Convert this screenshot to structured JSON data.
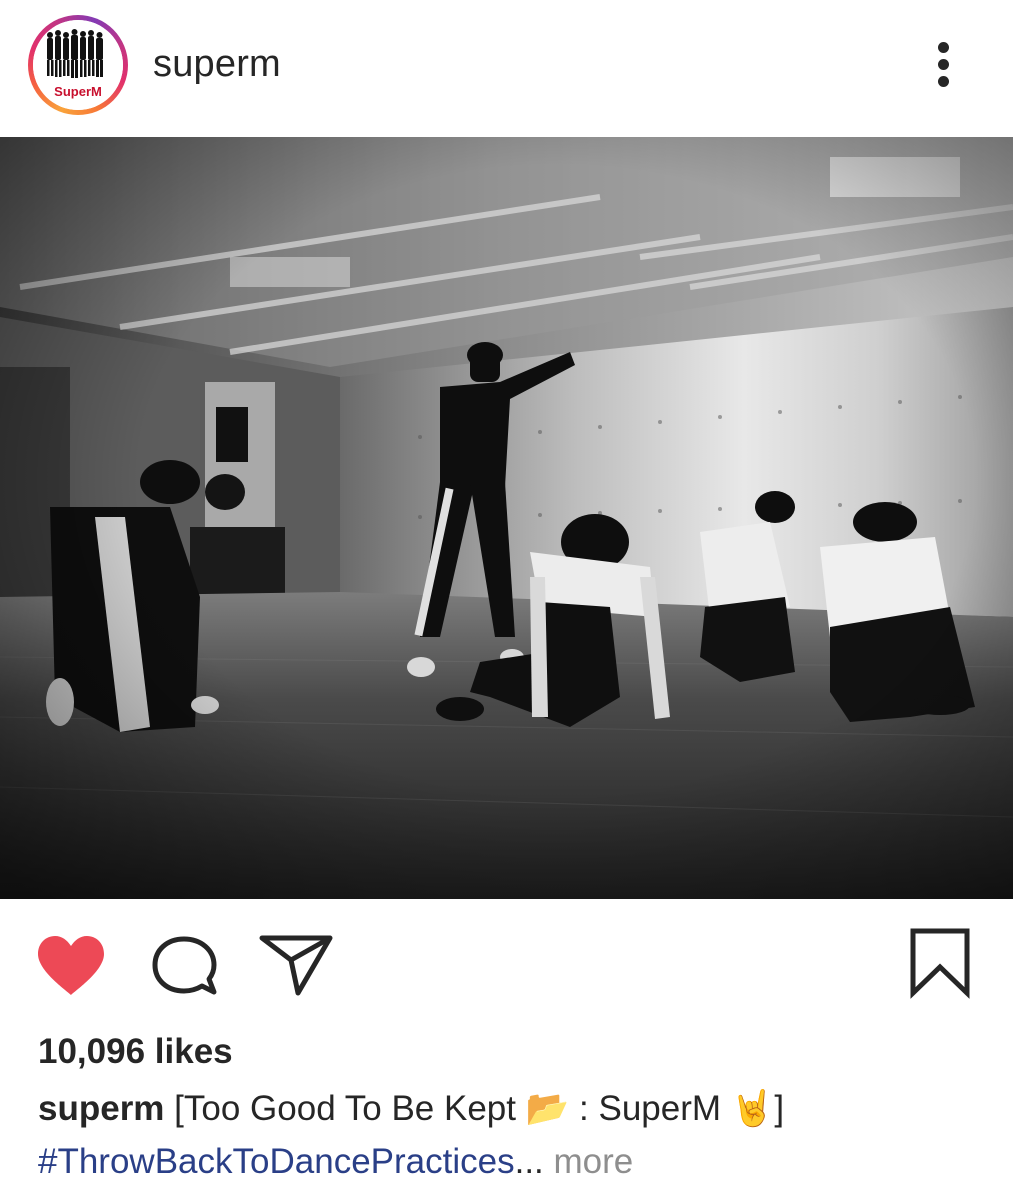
{
  "header": {
    "username": "superm",
    "avatar_text": "SuperM",
    "more_icon": "more-vertical-icon"
  },
  "post": {
    "image_description_icon": "photo",
    "actions": {
      "like_icon": "heart-filled-icon",
      "comment_icon": "comment-icon",
      "share_icon": "send-icon",
      "save_icon": "bookmark-icon",
      "like_color": "#ed4956"
    },
    "likes_text": "10,096 likes",
    "caption": {
      "username": "superm",
      "text_part1": "[Too Good To Be Kept ",
      "emoji_folder": "📂",
      "text_part2": " : SuperM ",
      "emoji_hand": "🤘",
      "text_part3": "]"
    },
    "hashtag": "#ThrowBackToDancePractices",
    "ellipsis": "...",
    "more_label": " more"
  },
  "colors": {
    "hashtag": "#2a3f87",
    "muted": "#8e8e8e",
    "text": "#262626"
  }
}
